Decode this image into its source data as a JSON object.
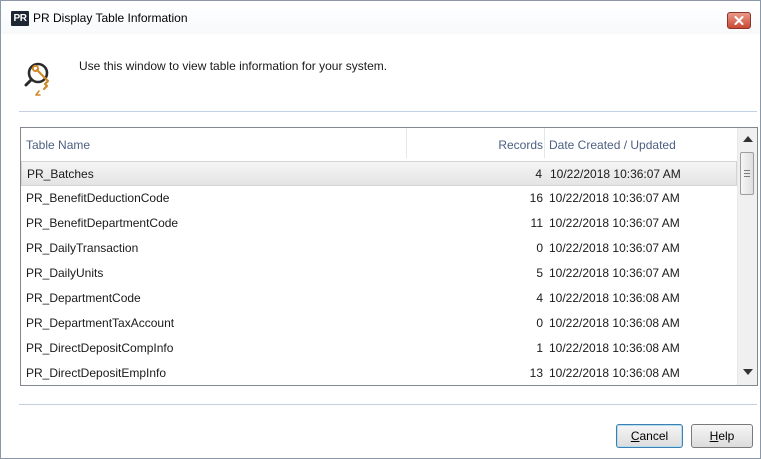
{
  "window": {
    "app_badge": "PR",
    "title": "PR Display Table Information",
    "close_glyph": "x"
  },
  "intro": {
    "icon": "key-search-icon",
    "text": "Use this window to view table information for your system."
  },
  "table": {
    "columns": [
      "Table Name",
      "Records",
      "Date Created / Updated"
    ],
    "rows": [
      {
        "name": "PR_Batches",
        "records": "4",
        "date": "10/22/2018 10:36:07 AM",
        "selected": true
      },
      {
        "name": "PR_BenefitDeductionCode",
        "records": "16",
        "date": "10/22/2018 10:36:07 AM"
      },
      {
        "name": "PR_BenefitDepartmentCode",
        "records": "11",
        "date": "10/22/2018 10:36:07 AM"
      },
      {
        "name": "PR_DailyTransaction",
        "records": "0",
        "date": "10/22/2018 10:36:07 AM"
      },
      {
        "name": "PR_DailyUnits",
        "records": "5",
        "date": "10/22/2018 10:36:07 AM"
      },
      {
        "name": "PR_DepartmentCode",
        "records": "4",
        "date": "10/22/2018 10:36:08 AM"
      },
      {
        "name": "PR_DepartmentTaxAccount",
        "records": "0",
        "date": "10/22/2018 10:36:08 AM"
      },
      {
        "name": "PR_DirectDepositCompInfo",
        "records": "1",
        "date": "10/22/2018 10:36:08 AM"
      },
      {
        "name": "PR_DirectDepositEmpInfo",
        "records": "13",
        "date": "10/22/2018 10:36:08 AM"
      }
    ]
  },
  "buttons": {
    "cancel_mnemonic": "C",
    "cancel_rest": "ancel",
    "help_mnemonic": "H",
    "help_rest": "elp"
  },
  "colors": {
    "header_text": "#4d6082",
    "divider": "#c3d2e2",
    "close_button": "#c94a35"
  }
}
